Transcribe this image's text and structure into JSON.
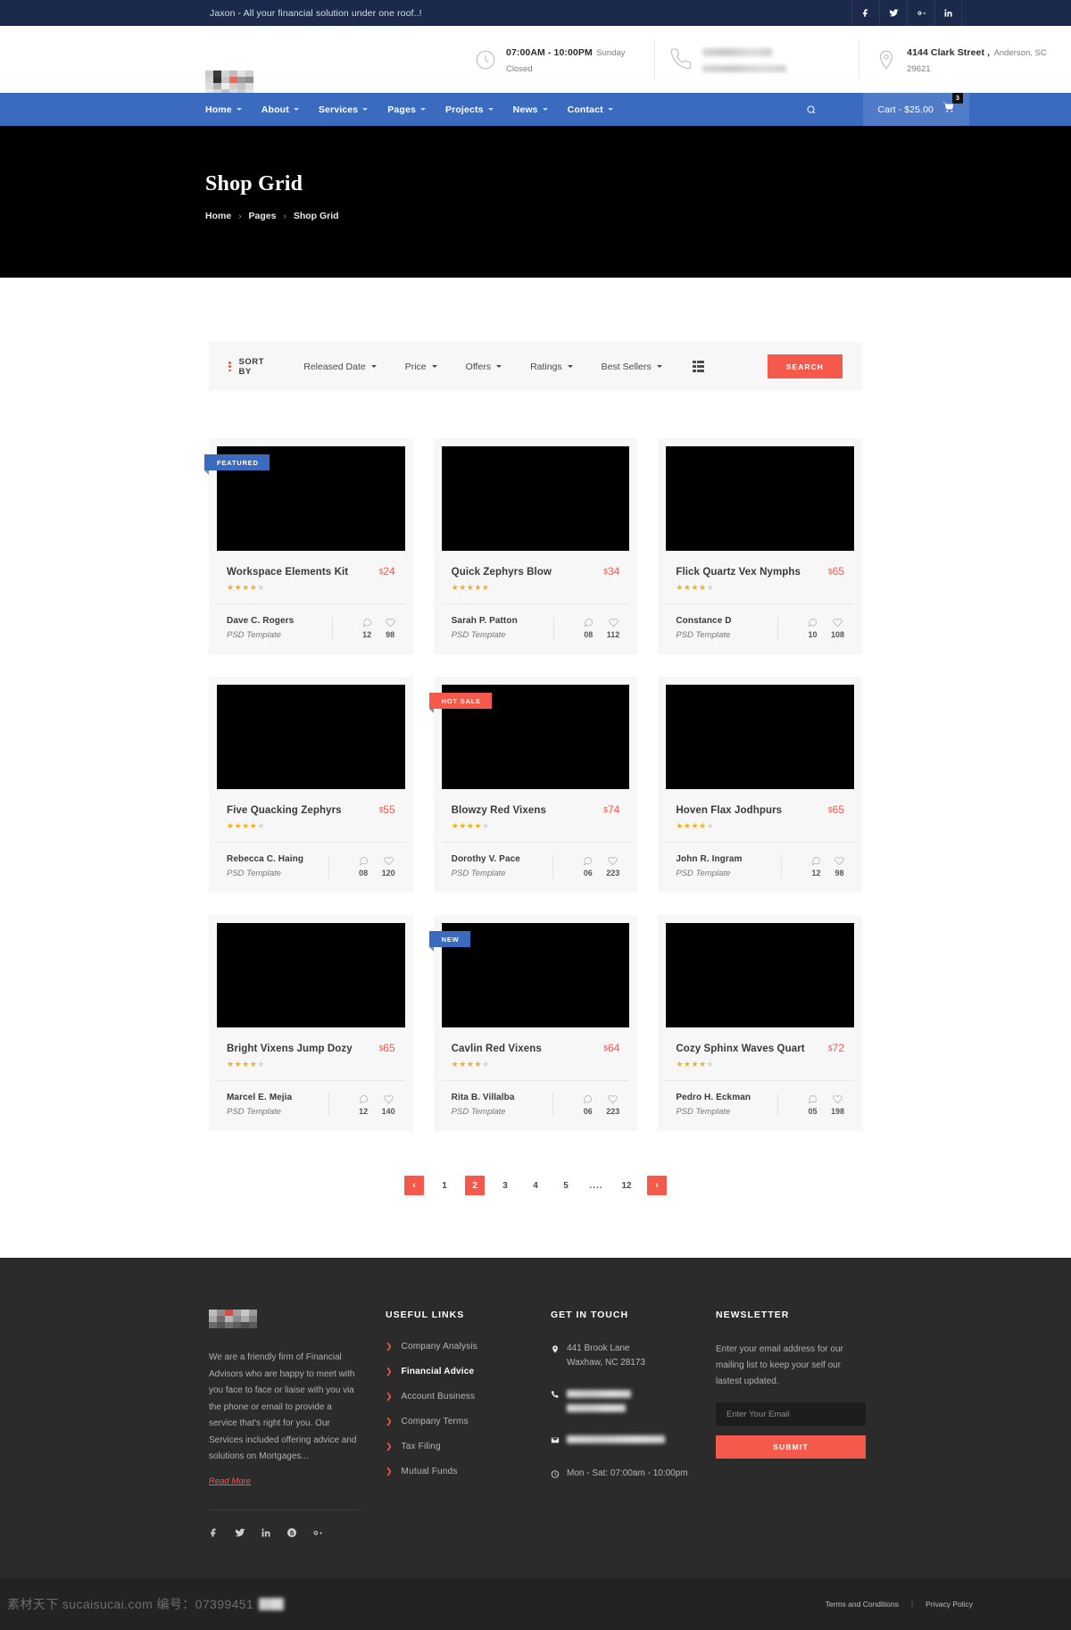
{
  "topbar": {
    "tagline": "Jaxon - All your financial solution under one roof..!",
    "social": [
      {
        "name": "facebook-icon",
        "label": "Facebook"
      },
      {
        "name": "twitter-icon",
        "label": "Twitter"
      },
      {
        "name": "google-plus-icon",
        "label": "Google Plus"
      },
      {
        "name": "linkedin-icon",
        "label": "LinkedIn"
      }
    ]
  },
  "header": {
    "logo_alt": "Jaxon",
    "info": [
      {
        "icon": "clock-icon",
        "line1": "07:00AM - 10:00PM",
        "line2": "Sunday Closed",
        "redacted": false
      },
      {
        "icon": "phone-icon",
        "line1": "",
        "line2": "",
        "redacted": true
      },
      {
        "icon": "map-pin-icon",
        "line1": "4144 Clark Street ,",
        "line2": "Anderson, SC 29621",
        "redacted": false
      }
    ]
  },
  "nav": {
    "items": [
      {
        "label": "Home",
        "has_dropdown": true
      },
      {
        "label": "About",
        "has_dropdown": true
      },
      {
        "label": "Services",
        "has_dropdown": true
      },
      {
        "label": "Pages",
        "has_dropdown": true
      },
      {
        "label": "Projects",
        "has_dropdown": true
      },
      {
        "label": "News",
        "has_dropdown": true
      },
      {
        "label": "Contact",
        "has_dropdown": true
      }
    ],
    "search_icon": "search-icon",
    "cart_label": "Cart - $25.00",
    "cart_count": "3"
  },
  "banner": {
    "title": "Shop Grid",
    "breadcrumb": [
      "Home",
      "Pages",
      "Shop Grid"
    ],
    "separator": "›"
  },
  "sortbar": {
    "sort_by_label": "SORT BY",
    "options": [
      "Released Date",
      "Price",
      "Offers",
      "Ratings",
      "Best Sellers"
    ],
    "view_list": "list-view-icon",
    "view_grid": "grid-view-icon",
    "search_label": "SEARCH"
  },
  "products": [
    {
      "title": "Workspace Elements Kit",
      "price": "24",
      "currency": "$",
      "rating": 4,
      "author": "Dave C. Rogers",
      "type": "PSD Template",
      "comments": "12",
      "likes": "98",
      "badge": {
        "text": "FEATURED",
        "style": "blue"
      }
    },
    {
      "title": "Quick Zephyrs Blow",
      "price": "34",
      "currency": "$",
      "rating": 5,
      "author": "Sarah P. Patton",
      "type": "PSD Template",
      "comments": "08",
      "likes": "112",
      "badge": null
    },
    {
      "title": "Flick Quartz Vex Nymphs",
      "price": "65",
      "currency": "$",
      "rating": 4,
      "author": "Constance D",
      "type": "PSD Template",
      "comments": "10",
      "likes": "108",
      "badge": null
    },
    {
      "title": "Five Quacking Zephyrs",
      "price": "55",
      "currency": "$",
      "rating": 4,
      "author": "Rebecca C. Haing",
      "type": "PSD Template",
      "comments": "08",
      "likes": "120",
      "badge": null
    },
    {
      "title": "Blowzy Red Vixens",
      "price": "74",
      "currency": "$",
      "rating": 4,
      "author": "Dorothy V. Pace",
      "type": "PSD Template",
      "comments": "06",
      "likes": "223",
      "badge": {
        "text": "HOT SALE",
        "style": "red"
      }
    },
    {
      "title": "Hoven Flax Jodhpurs",
      "price": "65",
      "currency": "$",
      "rating": 4,
      "author": "John R. Ingram",
      "type": "PSD Template",
      "comments": "12",
      "likes": "98",
      "badge": null
    },
    {
      "title": "Bright Vixens Jump Dozy",
      "price": "65",
      "currency": "$",
      "rating": 4,
      "author": "Marcel E. Mejia",
      "type": "PSD Template",
      "comments": "12",
      "likes": "140",
      "badge": null
    },
    {
      "title": "Cavlin Red Vixens",
      "price": "64",
      "currency": "$",
      "rating": 4,
      "author": "Rita B. Villalba",
      "type": "PSD Template",
      "comments": "06",
      "likes": "223",
      "badge": {
        "text": "NEW",
        "style": "blue"
      }
    },
    {
      "title": "Cozy Sphinx Waves Quart",
      "price": "72",
      "currency": "$",
      "rating": 4,
      "author": "Pedro H. Eckman",
      "type": "PSD Template",
      "comments": "05",
      "likes": "198",
      "badge": null
    }
  ],
  "pagination": {
    "prev": "‹",
    "next": "›",
    "pages": [
      "1",
      "2",
      "3",
      "4",
      "5",
      "....",
      "12"
    ],
    "active": "2"
  },
  "footer": {
    "about": {
      "text": "We are a friendly firm of Financial Advisors who are happy to meet with you face to face or liaise with you via the phone or email to provide a service that's right for you. Our Services included offering advice and solutions on Mortgages...",
      "read_more": "Read More",
      "social": [
        "facebook-icon",
        "twitter-icon",
        "linkedin-icon",
        "skype-icon",
        "google-plus-icon"
      ]
    },
    "useful_links": {
      "title": "USEFUL LINKS",
      "items": [
        {
          "label": "Company Analysis",
          "active": false
        },
        {
          "label": "Financial Advice",
          "active": true
        },
        {
          "label": "Account Business",
          "active": false
        },
        {
          "label": "Company Terms",
          "active": false
        },
        {
          "label": "Tax Filing",
          "active": false
        },
        {
          "label": "Mutual Funds",
          "active": false
        }
      ]
    },
    "get_in_touch": {
      "title": "GET IN TOUCH",
      "rows": [
        {
          "icon": "map-pin-icon",
          "value": "441 Brook Lane\nWaxhaw, NC 28173",
          "redacted": false
        },
        {
          "icon": "phone-icon",
          "value": "",
          "redacted": true
        },
        {
          "icon": "envelope-icon",
          "value": "",
          "redacted": true
        },
        {
          "icon": "clock-icon",
          "value": "Mon - Sat: 07:00am - 10:00pm",
          "redacted": false
        }
      ]
    },
    "newsletter": {
      "title": "NEWSLETTER",
      "text": "Enter your email address for our mailing list to keep your self our lastest updated.",
      "placeholder": "Enter Your Email",
      "submit_label": "SUBMIT"
    }
  },
  "bottombar": {
    "watermark": "素材天下 sucaisucai.com 编号：07399451",
    "links": [
      "Terms and Conditions",
      "Privacy Policy"
    ],
    "pipe": "|"
  },
  "colors": {
    "accent_red": "#f4594c",
    "brand_blue": "#3b6bbf",
    "topbar_navy": "#1b2a4a",
    "star_gold": "#f2b01e",
    "footer_dark": "#2b2b2b"
  }
}
